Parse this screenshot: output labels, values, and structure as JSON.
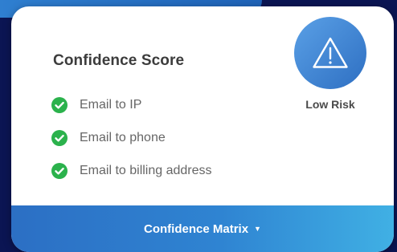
{
  "card": {
    "title": "Confidence Score",
    "checks": [
      {
        "label": "Email to IP",
        "icon": "check-circle-icon"
      },
      {
        "label": "Email to phone",
        "icon": "check-circle-icon"
      },
      {
        "label": "Email to billing address",
        "icon": "check-circle-icon"
      }
    ],
    "risk": {
      "icon": "warning-triangle-icon",
      "label": "Low Risk"
    },
    "footer": {
      "label": "Confidence Matrix",
      "icon": "caret-down-icon"
    }
  },
  "colors": {
    "background": "#0b1553",
    "check_green": "#2bb24c",
    "footer_gradient_start": "#2c6fc4",
    "footer_gradient_end": "#40b0e4",
    "risk_circle": "#3f86d6"
  }
}
